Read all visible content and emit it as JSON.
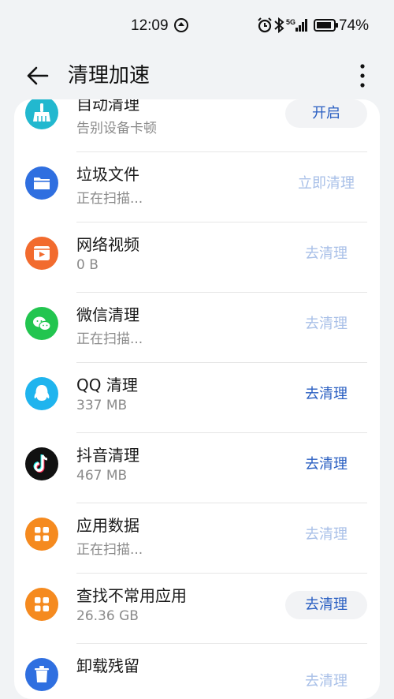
{
  "status_bar": {
    "time": "12:09",
    "battery": "74%",
    "icons": [
      "notification-icon",
      "alarm-icon",
      "bluetooth-icon",
      "signal-5g-icon",
      "battery-icon"
    ]
  },
  "header": {
    "title": "清理加速"
  },
  "rows": [
    {
      "title": "自动清理",
      "subtitle": "告别设备卡顿",
      "action": "开启",
      "icon": "broom-icon",
      "color": "#22b8cf",
      "action_state": "active"
    },
    {
      "title": "垃圾文件",
      "subtitle": "正在扫描...",
      "action": "立即清理",
      "icon": "folder-icon",
      "color": "#2f6fe0",
      "action_state": "disabled"
    },
    {
      "title": "网络视频",
      "subtitle": "0 B",
      "action": "去清理",
      "icon": "video-icon",
      "color": "#f26b2e",
      "action_state": "disabled"
    },
    {
      "title": "微信清理",
      "subtitle": "正在扫描...",
      "action": "去清理",
      "icon": "wechat-icon",
      "color": "#22c54f",
      "action_state": "disabled"
    },
    {
      "title": "QQ 清理",
      "subtitle": "337 MB",
      "action": "去清理",
      "icon": "qq-icon",
      "color": "#1fb4ee",
      "action_state": "active"
    },
    {
      "title": "抖音清理",
      "subtitle": "467 MB",
      "action": "去清理",
      "icon": "tiktok-icon",
      "color": "#111111",
      "action_state": "active"
    },
    {
      "title": "应用数据",
      "subtitle": "正在扫描...",
      "action": "去清理",
      "icon": "app-grid-icon",
      "color": "#f58a1f",
      "action_state": "disabled"
    },
    {
      "title": "查找不常用应用",
      "subtitle": "26.36 GB",
      "action": "去清理",
      "icon": "app-grid-icon",
      "color": "#f58a1f",
      "action_state": "active"
    },
    {
      "title": "卸载残留",
      "subtitle": "",
      "action": "去清理",
      "icon": "trash-icon",
      "color": "#2f6fe0",
      "action_state": "disabled"
    }
  ]
}
